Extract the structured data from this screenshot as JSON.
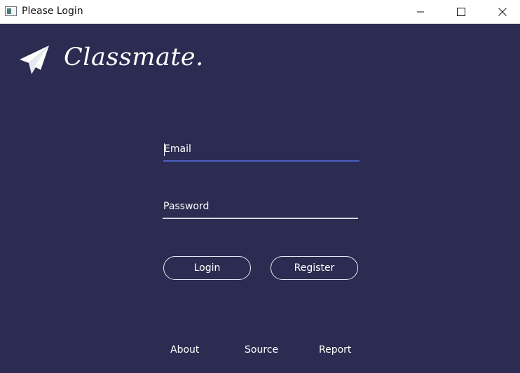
{
  "window": {
    "title": "Please Login",
    "icon": "app-window-icon",
    "controls": [
      "minimize-icon",
      "maximize-icon",
      "close-icon"
    ]
  },
  "brand": {
    "name": "Classmate.",
    "icon": "paper-plane-icon"
  },
  "form": {
    "email_placeholder": "Email",
    "email_value": "",
    "password_placeholder": "Password",
    "password_value": "",
    "login_label": "Login",
    "register_label": "Register"
  },
  "footer": {
    "about_label": "About",
    "source_label": "Source",
    "report_label": "Report"
  },
  "colors": {
    "background": "#2c2b51",
    "focus_underline": "#4a5fc1",
    "text": "#ffffff"
  }
}
